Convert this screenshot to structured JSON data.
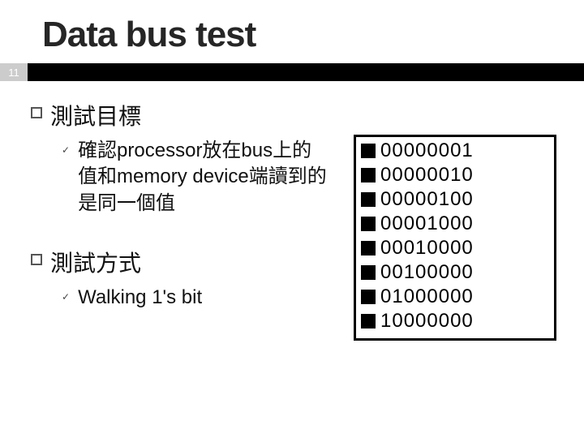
{
  "title": "Data bus test",
  "page_number": "11",
  "sections": [
    {
      "heading": "測試目標",
      "items": [
        "確認processor放在bus上的值和memory device端讀到的是同一個值"
      ]
    },
    {
      "heading": "測試方式",
      "items": [
        "Walking 1's bit"
      ]
    }
  ],
  "bit_patterns": [
    "00000001",
    "00000010",
    "00000100",
    "00001000",
    "00010000",
    "00100000",
    "01000000",
    "10000000"
  ]
}
